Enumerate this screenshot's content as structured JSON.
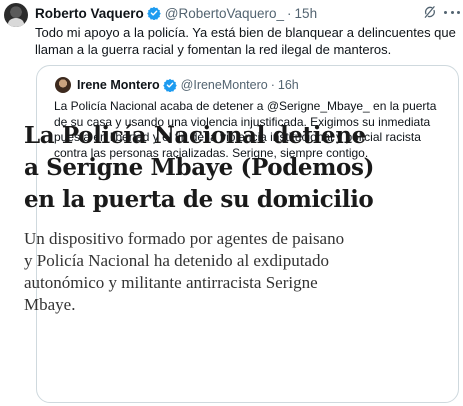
{
  "tweet": {
    "author_name": "Roberto Vaquero",
    "handle": "@RobertoVaquero_",
    "separator": "·",
    "time": "15h",
    "text": "Todo mi apoyo a la policía. Ya está bien de blanquear a delincuentes que llaman a la guerra racial y fomentan la red ilegal de manteros."
  },
  "quote": {
    "author_name": "Irene Montero",
    "handle": "@IreneMontero",
    "separator": "·",
    "time": "16h",
    "text": "La Policía Nacional acaba de detener a @Serigne_Mbaye_ en la puerta de su casa y usando una violencia injustificada. Exigimos su inmediata puesta en libertad y el fin de la violencia institucional y policial racista contra las personas racializadas. Serigne, siempre contigo.",
    "article": {
      "headline": "La Policía Nacional detiene\na Serigne Mbaye (Podemos)\nen la puerta de su domicilio",
      "subhead": "Un dispositivo formado por agentes de paisano\ny Policía Nacional ha detenido al exdiputado\nautonómico y militante antirracista Serigne\nMbaye."
    }
  },
  "icons": {
    "verified": "verified-badge-icon",
    "grok": "grok-icon",
    "more": "more-options-icon"
  },
  "colors": {
    "verified_blue": "#1d9bf0",
    "muted": "#536471",
    "border": "#cfd9de"
  }
}
